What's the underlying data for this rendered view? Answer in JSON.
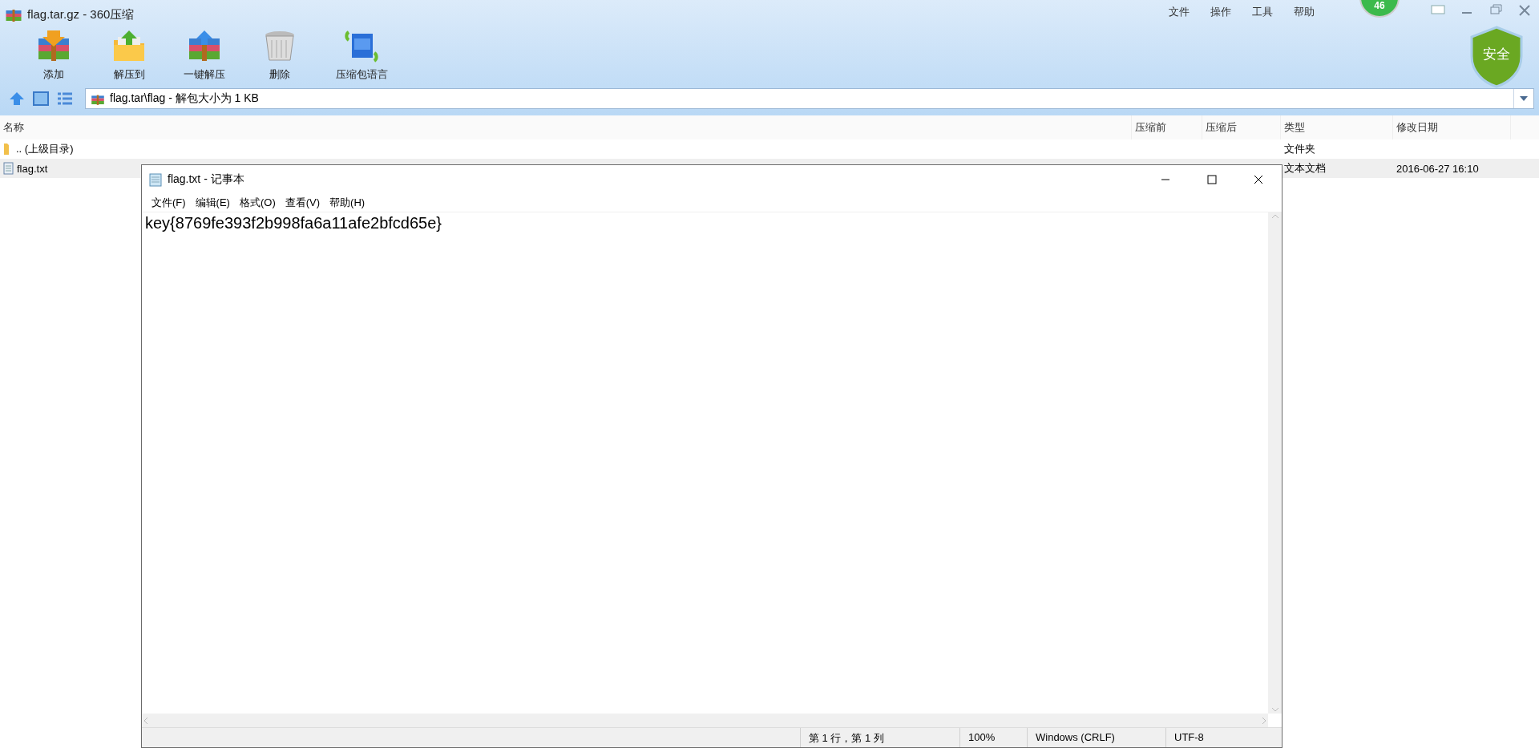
{
  "window": {
    "title": "flag.tar.gz - 360压缩"
  },
  "menu": [
    "文件",
    "操作",
    "工具",
    "帮助"
  ],
  "badge": "46",
  "shield": "安全",
  "toolbar": [
    {
      "label": "添加",
      "kind": "add"
    },
    {
      "label": "解压到",
      "kind": "extract"
    },
    {
      "label": "一键解压",
      "kind": "quick"
    },
    {
      "label": "删除",
      "kind": "delete"
    },
    {
      "label": "压缩包语言",
      "kind": "language"
    }
  ],
  "address": {
    "value": "flag.tar\\flag - 解包大小为 1 KB"
  },
  "table": {
    "columns": [
      "名称",
      "压缩前",
      "压缩后",
      "类型",
      "修改日期"
    ],
    "rows": [
      {
        "kind": "folder",
        "name": ".. (上级目录)",
        "type": "文件夹",
        "selected": false
      },
      {
        "kind": "file",
        "name": "flag.txt",
        "type": "文本文档",
        "date": "2016-06-27 16:10",
        "selected": true
      }
    ]
  },
  "notepad": {
    "title": "flag.txt - 记事本",
    "menu": [
      "文件(F)",
      "编辑(E)",
      "格式(O)",
      "查看(V)",
      "帮助(H)"
    ],
    "content": "key{8769fe393f2b998fa6a11afe2bfcd65e}",
    "status_bar": [
      "第 1 行，第 1 列",
      "100%",
      "Windows (CRLF)",
      "UTF-8"
    ]
  }
}
